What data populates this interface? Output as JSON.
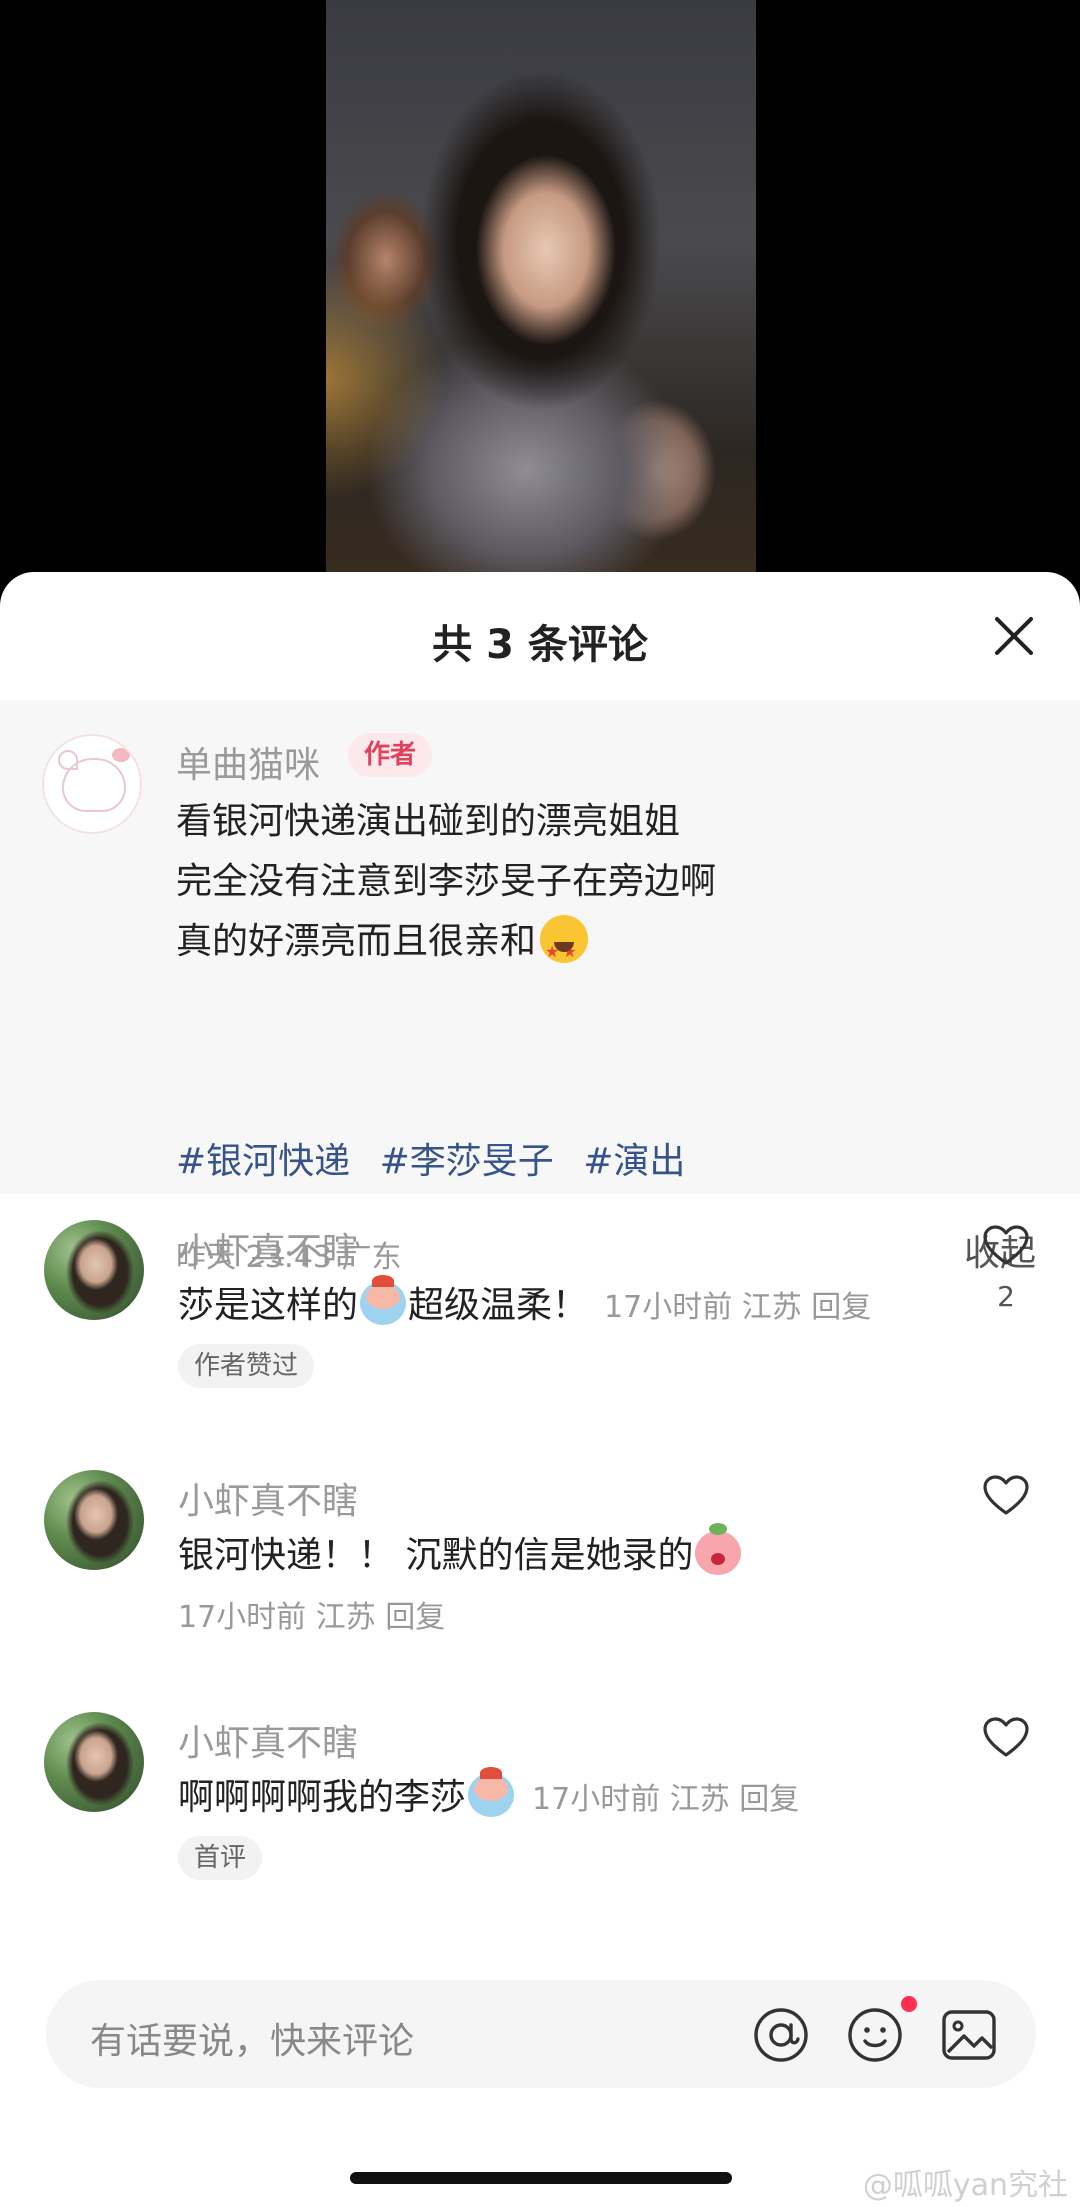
{
  "sheet": {
    "title": "共 3 条评论"
  },
  "post": {
    "author": "单曲猫咪",
    "author_badge": "作者",
    "lines": [
      "看银河快递演出碰到的漂亮姐姐",
      "完全没有注意到李莎旻子在旁边啊",
      "真的好漂亮而且很亲和"
    ],
    "hashtags": [
      "#银河快递",
      "#李莎旻子",
      "#演出"
    ],
    "meta": "昨天 23:43 广东",
    "collapse_label": "收起"
  },
  "comments": [
    {
      "name": "小虾真不瞎",
      "text_before": "莎是这样的",
      "text_after": "超级温柔！",
      "meta": "17小时前 江苏 回复",
      "likes": "2",
      "tag": "作者赞过"
    },
    {
      "name": "小虾真不瞎",
      "text_before": "银河快递！！ 沉默的信是她录的",
      "meta": "17小时前 江苏 回复"
    },
    {
      "name": "小虾真不瞎",
      "text_before": "啊啊啊啊我的李莎",
      "meta": "17小时前 江苏 回复",
      "tag": "首评"
    }
  ],
  "input": {
    "placeholder": "有话要说，快来评论"
  },
  "watermark": "@呱呱yan究社",
  "colors": {
    "hashtag": "#37548a",
    "badge_text": "#e0415c",
    "badge_bg": "#fde9ec",
    "notification_dot": "#ff2d4e"
  }
}
